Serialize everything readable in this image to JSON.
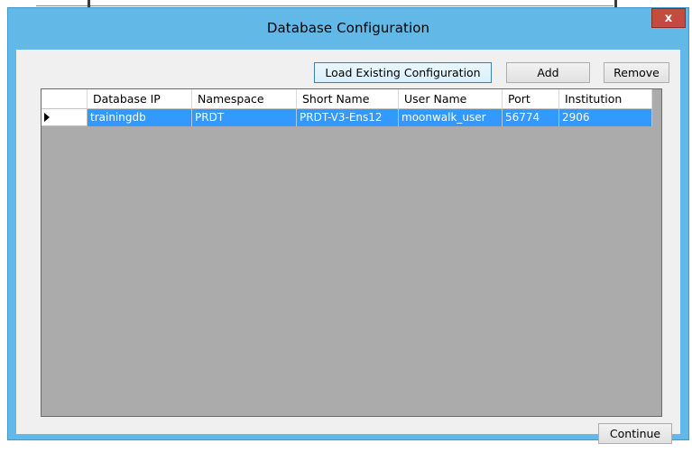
{
  "window": {
    "title": "Database Configuration",
    "close_label": "x"
  },
  "toolbar": {
    "load_label": "Load Existing Configuration",
    "add_label": "Add",
    "remove_label": "Remove"
  },
  "grid": {
    "columns": [
      "Database IP",
      "Namespace",
      "Short Name",
      "User Name",
      "Port",
      "Institution"
    ],
    "rows": [
      [
        "trainingdb",
        "PRDT",
        "PRDT-V3-Ens12",
        "moonwalk_user",
        "56774",
        "2906"
      ]
    ],
    "selected_row": 0
  },
  "footer": {
    "continue_label": "Continue"
  },
  "colors": {
    "titlebar": "#62b9e8",
    "selection": "#3399ff",
    "close": "#c44b3f",
    "grid_background": "#ababab"
  }
}
